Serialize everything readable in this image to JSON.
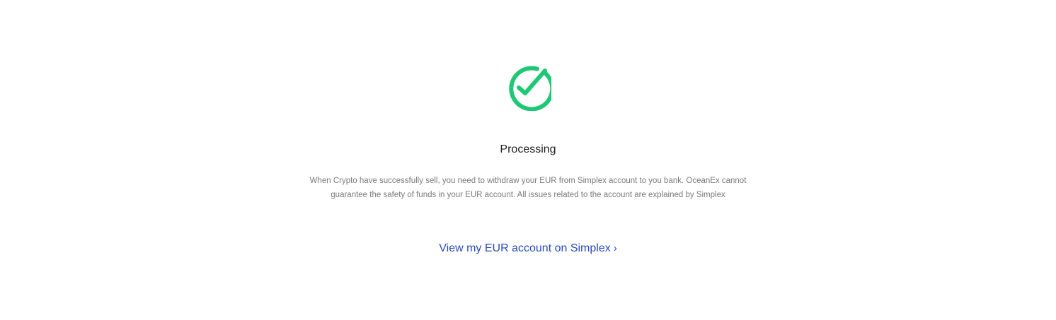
{
  "status": {
    "icon": "check-circle-icon",
    "title": "Processing",
    "message_line_1": "When Crypto have successfully sell, you need to withdraw your EUR from Simplex account to you bank. OceanEx cannot",
    "message_line_2": "guarantee the safety of funds in your EUR account. All issues related to the account are explained by Simplex"
  },
  "link": {
    "label": "View my EUR account on Simplex",
    "chevron": "›",
    "icon": "chevron-right-icon"
  },
  "colors": {
    "success": "#1fc776",
    "link": "#2a4bb5",
    "title": "#222222",
    "body_text": "#7a7a7a",
    "background": "#ffffff"
  }
}
